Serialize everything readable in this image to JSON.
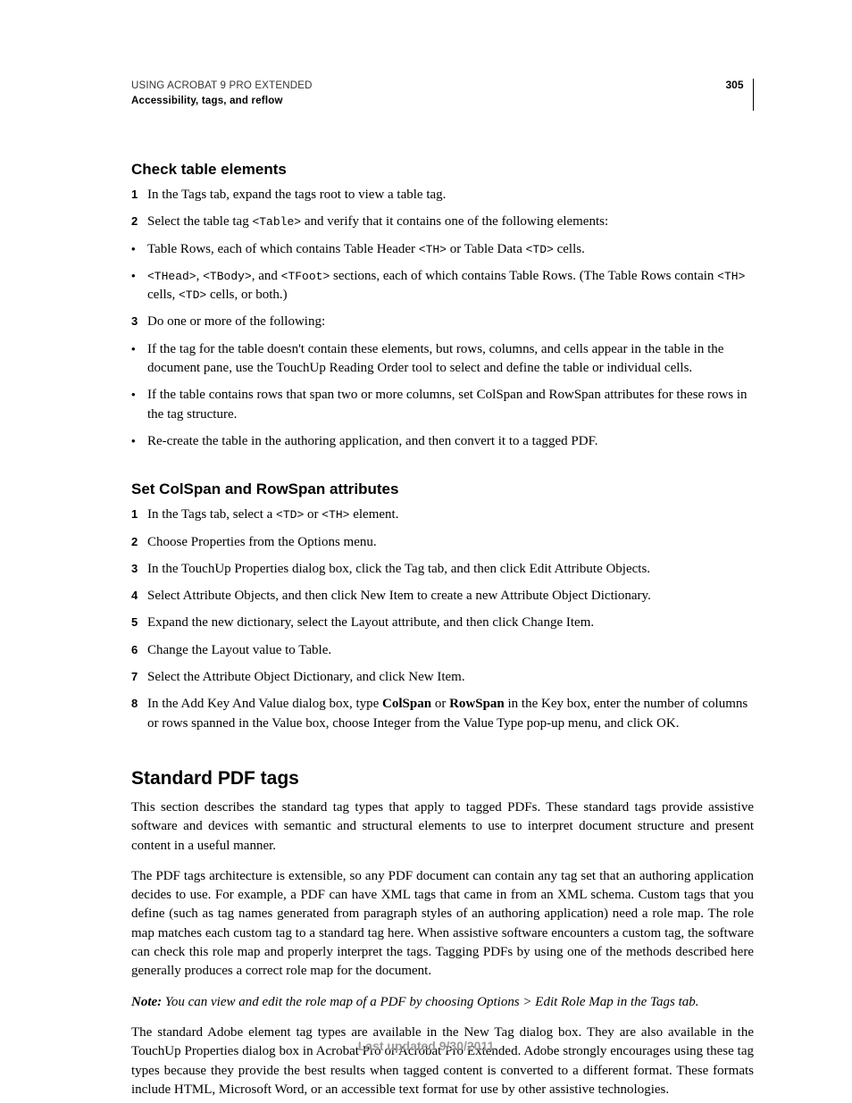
{
  "header": {
    "doc_title": "USING ACROBAT 9 PRO EXTENDED",
    "chapter": "Accessibility, tags, and reflow",
    "page_number": "305"
  },
  "sections": {
    "check_table": {
      "heading": "Check table elements",
      "items": [
        {
          "marker": "1",
          "pre": "In the Tags tab, expand the tags root to view a table tag."
        },
        {
          "marker": "2",
          "pre": "Select the table tag ",
          "code1": "<Table>",
          "post": " and verify that it contains one of the following elements:"
        },
        {
          "marker": "•",
          "pre": "Table Rows, each of which contains Table Header ",
          "code1": "<TH>",
          "mid": " or Table Data ",
          "code2": "<TD>",
          "post": " cells."
        },
        {
          "marker": "•",
          "code1": "<THead>",
          "t1": ", ",
          "code2": "<TBody>",
          "t2": ", and ",
          "code3": "<TFoot>",
          "t3": " sections, each of which contains Table Rows. (The Table Rows contain ",
          "code4": "<TH>",
          "t4": " cells, ",
          "code5": "<TD>",
          "t5": " cells, or both.)"
        },
        {
          "marker": "3",
          "pre": "Do one or more of the following:"
        },
        {
          "marker": "•",
          "pre": "If the tag for the table doesn't contain these elements, but rows, columns, and cells appear in the table in the document pane, use the TouchUp Reading Order tool to select and define the table or individual cells."
        },
        {
          "marker": "•",
          "pre": "If the table contains rows that span two or more columns, set ColSpan and RowSpan attributes for these rows in the tag structure."
        },
        {
          "marker": "•",
          "pre": "Re-create the table in the authoring application, and then convert it to a tagged PDF."
        }
      ]
    },
    "colspan": {
      "heading": "Set ColSpan and RowSpan attributes",
      "items": [
        {
          "marker": "1",
          "pre": "In the Tags tab, select a ",
          "code1": "<TD>",
          "mid": " or ",
          "code2": "<TH>",
          "post": " element."
        },
        {
          "marker": "2",
          "pre": "Choose Properties from the Options menu."
        },
        {
          "marker": "3",
          "pre": "In the TouchUp Properties dialog box, click the Tag tab, and then click Edit Attribute Objects."
        },
        {
          "marker": "4",
          "pre": "Select Attribute Objects, and then click New Item to create a new Attribute Object Dictionary."
        },
        {
          "marker": "5",
          "pre": "Expand the new dictionary, select the Layout attribute, and then click Change Item."
        },
        {
          "marker": "6",
          "pre": "Change the Layout value to Table."
        },
        {
          "marker": "7",
          "pre": "Select the Attribute Object Dictionary, and click New Item."
        },
        {
          "marker": "8",
          "pre": "In the Add Key And Value dialog box, type ",
          "b1": "ColSpan",
          "mid": " or ",
          "b2": "RowSpan",
          "post": " in the Key box, enter the number of columns or rows spanned in the Value box, choose Integer from the Value Type pop-up menu, and click OK."
        }
      ]
    },
    "standard": {
      "heading": "Standard PDF tags",
      "p1": "This section describes the standard tag types that apply to tagged PDFs. These standard tags provide assistive software and devices with semantic and structural elements to use to interpret document structure and present content in a useful manner.",
      "p2": "The PDF tags architecture is extensible, so any PDF document can contain any tag set that an authoring application decides to use. For example, a PDF can have XML tags that came in from an XML schema. Custom tags that you define (such as tag names generated from paragraph styles of an authoring application) need a role map. The role map matches each custom tag to a standard tag here. When assistive software encounters a custom tag, the software can check this role map and properly interpret the tags. Tagging PDFs by using one of the methods described here generally produces a correct role map for the document.",
      "note_label": "Note:",
      "note_body": " You can view and edit the role map of a PDF by choosing Options > Edit Role Map in the Tags tab.",
      "p3": "The standard Adobe element tag types are available in the New Tag dialog box. They are also available in the TouchUp Properties dialog box in Acrobat Pro or Acrobat Pro Extended. Adobe strongly encourages using these tag types because they provide the best results when tagged content is converted to a different format. These formats include HTML, Microsoft Word, or an accessible text format for use by other assistive technologies."
    }
  },
  "footer": "Last updated 9/30/2011"
}
